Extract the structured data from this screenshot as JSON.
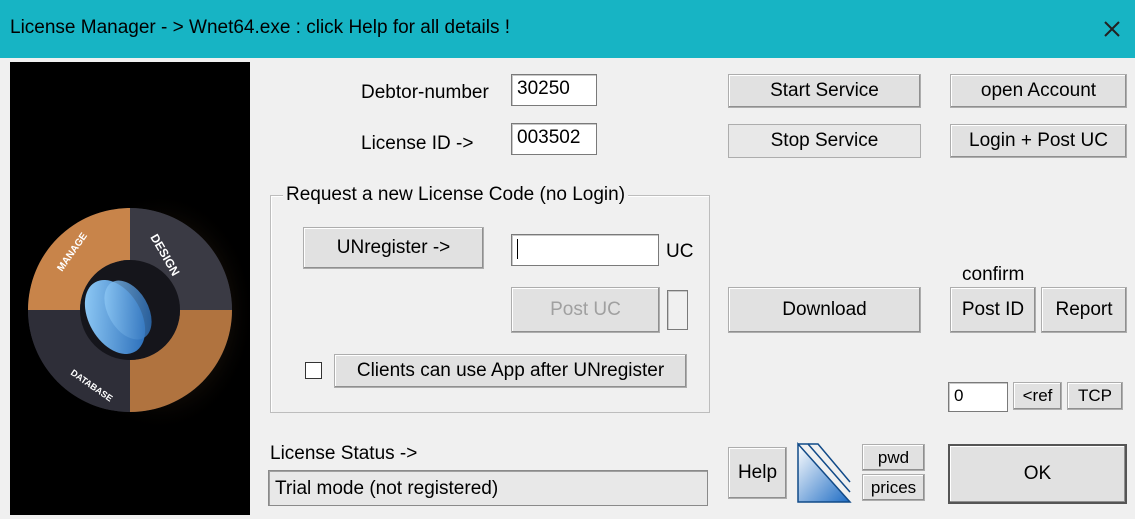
{
  "window": {
    "title": "License Manager - > Wnet64.exe : click Help for all details !"
  },
  "logo": {
    "ring_labels": [
      "MANAGE",
      "DESIGN",
      "DATABASE"
    ]
  },
  "account": {
    "debtor_label": "Debtor-number",
    "debtor_value": "30250",
    "license_label": "License ID  ->",
    "license_value": "003502"
  },
  "request_group": {
    "legend": "Request a new License Code (no Login)",
    "unregister_label": "UNregister ->",
    "uc_value": "",
    "uc_label": "UC",
    "post_uc_label": "Post UC",
    "clients_checked": false,
    "clients_label": "Clients can use App after UNregister"
  },
  "service": {
    "start_label": "Start Service",
    "stop_label": "Stop Service",
    "download_label": "Download"
  },
  "account_actions": {
    "open_account_label": "open Account",
    "login_post_label": "Login + Post UC",
    "confirm_label": "confirm",
    "post_id_label": "Post ID",
    "report_label": "Report",
    "ref_value": "0",
    "ref_label": "<ref",
    "tcp_label": "TCP"
  },
  "status": {
    "label": "License Status ->",
    "value": "Trial mode (not registered)"
  },
  "bottom": {
    "help_label": "Help",
    "pwd_label": "pwd",
    "prices_label": "prices",
    "ok_label": "OK"
  },
  "colors": {
    "titlebar": "#17b4c4",
    "face": "#f0f0f0",
    "logo_background": "#000000",
    "logo_accent": "#c8844a"
  }
}
